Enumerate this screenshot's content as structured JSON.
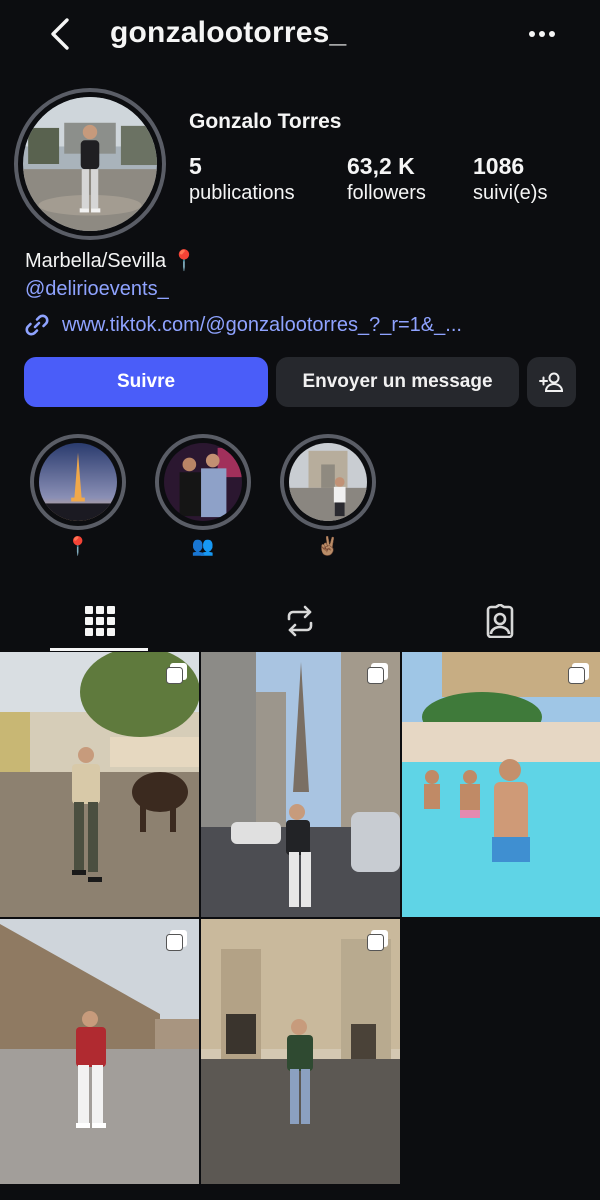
{
  "header": {
    "username": "gonzalootorres_",
    "back_icon": "chevron-left-icon",
    "more_icon": "more-horizontal-icon"
  },
  "profile": {
    "display_name": "Gonzalo Torres",
    "stats": [
      {
        "value": "5",
        "label": "publications"
      },
      {
        "value": "63,2 K",
        "label": "followers"
      },
      {
        "value": "1086",
        "label": "suivi(e)s"
      }
    ],
    "bio": "Marbella/Sevilla 📍",
    "mention": "@delirioevents_",
    "website": "www.tiktok.com/@gonzalootorres_?_r=1&_..."
  },
  "actions": {
    "follow": "Suivre",
    "message": "Envoyer un message",
    "add_user_icon": "add-user-icon"
  },
  "highlights": [
    {
      "label": "📍",
      "scene": "eiffel-tower-sunset"
    },
    {
      "label": "👥",
      "scene": "two-friends-night"
    },
    {
      "label": "✌🏽",
      "scene": "arc-de-triomphe"
    }
  ],
  "tabs": [
    {
      "name": "posts-grid",
      "icon": "grid-icon",
      "active": true
    },
    {
      "name": "reposts",
      "icon": "repost-icon",
      "active": false
    },
    {
      "name": "tagged",
      "icon": "tagged-person-icon",
      "active": false
    }
  ],
  "colors": {
    "accent": "#4a5df9",
    "link": "#8fa3ff",
    "background": "#0c0d10",
    "button_dark": "#26282d"
  }
}
